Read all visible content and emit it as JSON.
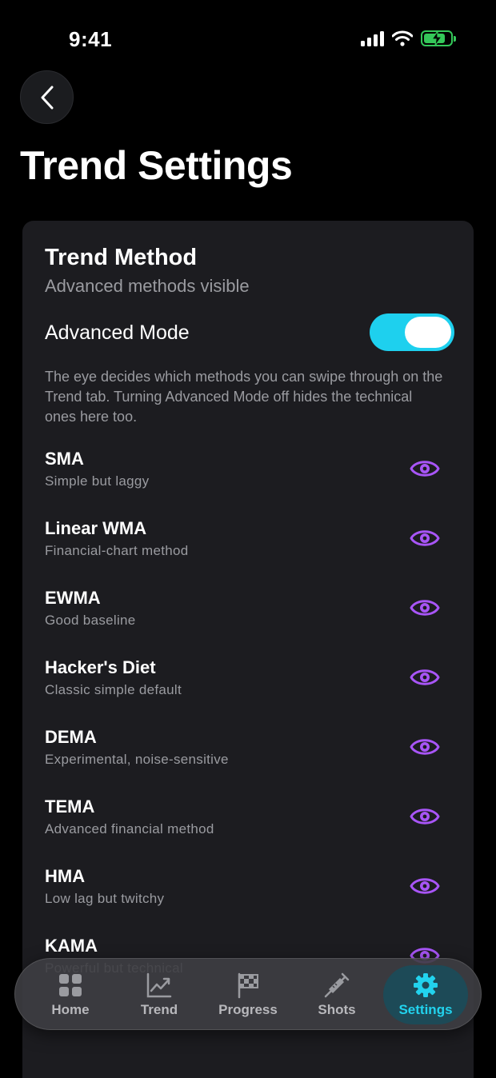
{
  "status": {
    "time": "9:41"
  },
  "header": {
    "title": "Trend Settings"
  },
  "card": {
    "title": "Trend Method",
    "subtitle": "Advanced methods visible",
    "advanced_label": "Advanced Mode",
    "advanced_on": true,
    "help": "The eye decides which methods you can swipe through on the Trend tab. Turning Advanced Mode off hides the technical ones here too."
  },
  "methods": [
    {
      "name": "SMA",
      "desc": "Simple but laggy"
    },
    {
      "name": "Linear WMA",
      "desc": "Financial-chart method"
    },
    {
      "name": "EWMA",
      "desc": "Good baseline"
    },
    {
      "name": "Hacker's Diet",
      "desc": "Classic simple default"
    },
    {
      "name": "DEMA",
      "desc": "Experimental, noise-sensitive"
    },
    {
      "name": "TEMA",
      "desc": "Advanced financial method"
    },
    {
      "name": "HMA",
      "desc": "Low lag but twitchy"
    },
    {
      "name": "KAMA",
      "desc": "Powerful but technical"
    }
  ],
  "tabs": [
    {
      "label": "Home",
      "icon": "grid-icon"
    },
    {
      "label": "Trend",
      "icon": "trend-chart-icon"
    },
    {
      "label": "Progress",
      "icon": "checkered-flag-icon"
    },
    {
      "label": "Shots",
      "icon": "syringe-icon"
    },
    {
      "label": "Settings",
      "icon": "gear-icon",
      "active": true
    }
  ],
  "colors": {
    "accent": "#22d3ee",
    "toggle": "#1ed0ee",
    "eye": "#a855f7",
    "background": "#000000",
    "card": "#1c1c20"
  }
}
